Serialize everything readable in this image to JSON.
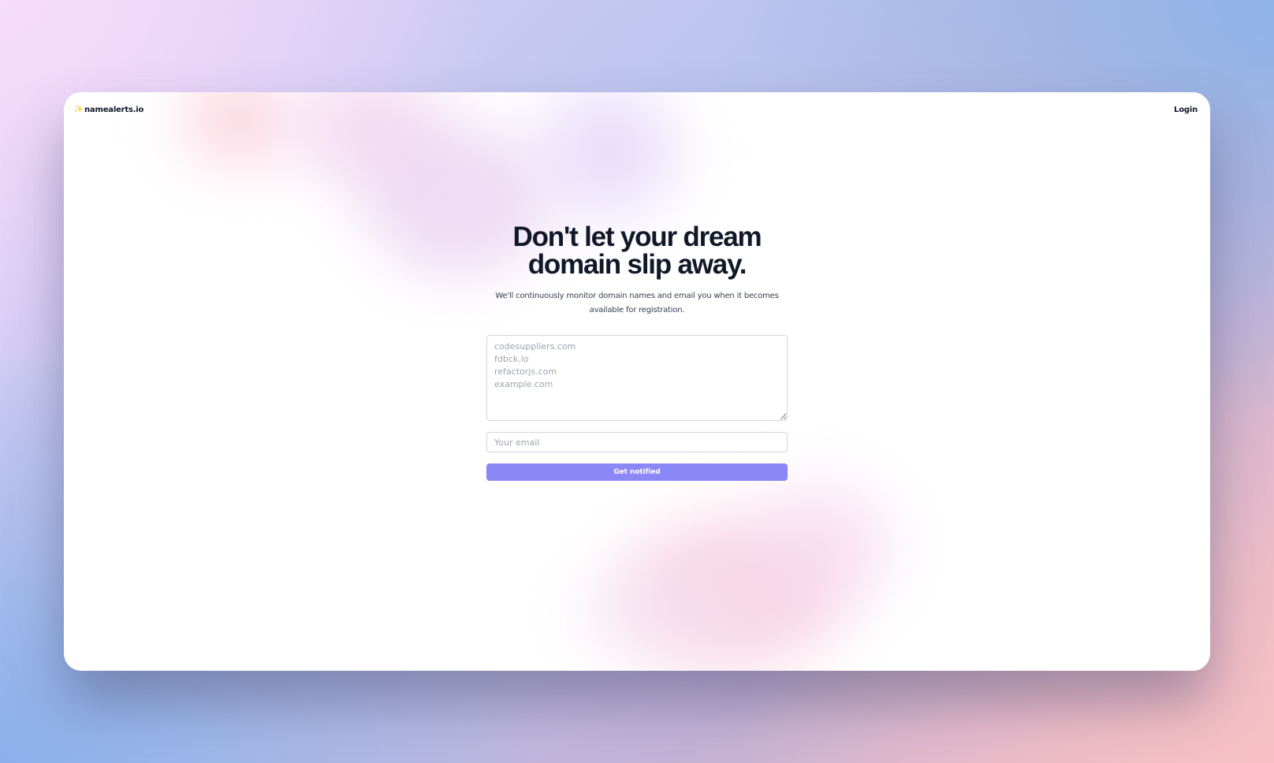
{
  "nav": {
    "brand_icon": "sparkle-icon",
    "brand_name": "namealerts.io",
    "login_label": "Login"
  },
  "hero": {
    "headline_line1": "Don't let your dream",
    "headline_line2": "domain slip away.",
    "subtext": "We'll continuously monitor domain names and email you when it becomes available for registration."
  },
  "form": {
    "domains_placeholder": "codesuppliers.com\nfdbck.io\nrefactorjs.com\nexample.com",
    "domains_value": "",
    "email_placeholder": "Your email",
    "email_value": "",
    "submit_label": "Get notified"
  },
  "colors": {
    "accent": "#8b87f6",
    "text": "#111827",
    "sparkle": "#f5c33b"
  }
}
